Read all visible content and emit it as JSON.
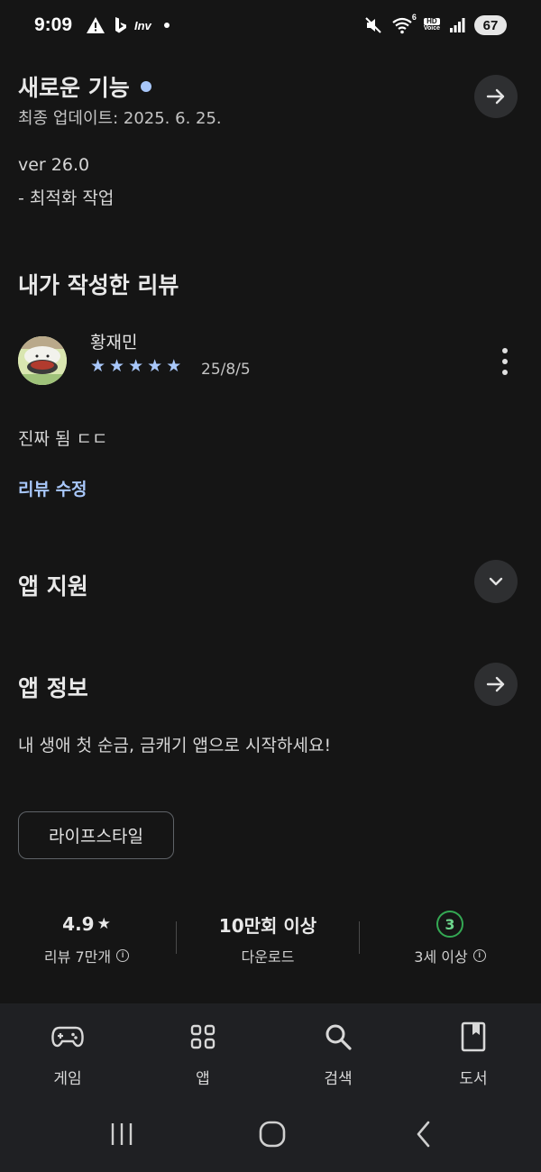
{
  "status_bar": {
    "time": "9:09",
    "battery": "67",
    "hd_top": "HD",
    "hd_bottom": "Voice",
    "network_small": "6",
    "inv_label": "Inv"
  },
  "whats_new": {
    "title": "새로운 기능",
    "updated": "최종 업데이트: 2025. 6. 25.",
    "version": "ver 26.0",
    "note": "- 최적화 작업"
  },
  "my_review": {
    "section_title": "내가 작성한 리뷰",
    "reviewer": "황재민",
    "rating": 5,
    "date": "25/8/5",
    "text": "진짜 됨 ㄷㄷ",
    "edit_link": "리뷰 수정"
  },
  "app_support": {
    "title": "앱 지원"
  },
  "app_info": {
    "title": "앱 정보",
    "description": "내 생애 첫 순금, 금캐기 앱으로 시작하세요!",
    "category_chip": "라이프스타일"
  },
  "stats": {
    "rating_value": "4.9",
    "rating_label": "리뷰 7만개",
    "downloads_value": "10만회 이상",
    "downloads_label": "다운로드",
    "age_value": "3",
    "age_label": "3세 이상"
  },
  "bottom_nav": {
    "items": [
      {
        "label": "게임",
        "icon": "gamepad-icon"
      },
      {
        "label": "앱",
        "icon": "apps-grid-icon"
      },
      {
        "label": "검색",
        "icon": "search-icon"
      },
      {
        "label": "도서",
        "icon": "book-icon"
      }
    ]
  },
  "colors": {
    "background": "#151515",
    "accent": "#a8c7fa",
    "age_green": "#34a853",
    "nav_background": "#1f2023"
  }
}
